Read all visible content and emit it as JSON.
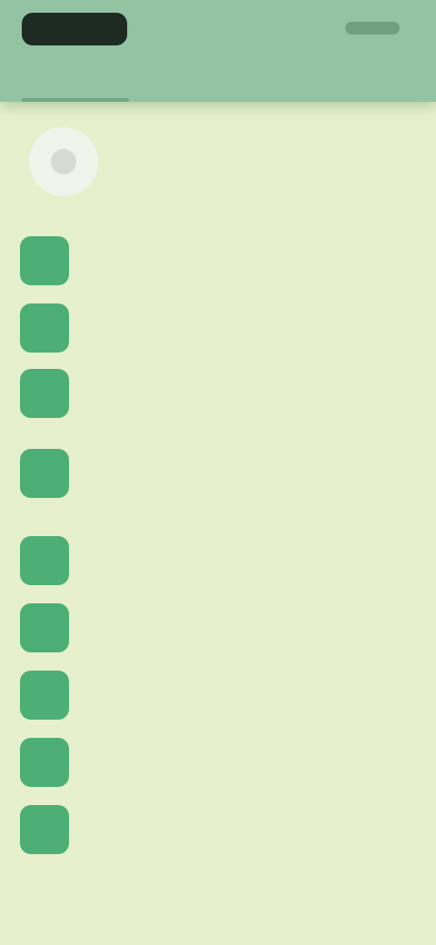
{
  "status_bar": {
    "time": "",
    "indicators": ""
  },
  "tabs": [
    {
      "label": ""
    },
    {
      "label": ""
    }
  ],
  "profile": {
    "name": "",
    "avatar_icon": "user-avatar-icon"
  },
  "menu": {
    "items": [
      {
        "label": "",
        "icon": "menu-item-icon"
      },
      {
        "label": "",
        "icon": "menu-item-icon"
      },
      {
        "label": "",
        "icon": "menu-item-icon"
      },
      {
        "label": "",
        "icon": "menu-item-icon"
      },
      {
        "label": "",
        "icon": "menu-item-icon"
      },
      {
        "label": "",
        "icon": "menu-item-icon"
      },
      {
        "label": "",
        "icon": "menu-item-icon"
      },
      {
        "label": "",
        "icon": "menu-item-icon"
      },
      {
        "label": "",
        "icon": "menu-item-icon"
      }
    ]
  },
  "colors": {
    "header_bg": "#93c3a3",
    "page_bg": "#e6f0cd",
    "icon_accent": "#4daf75"
  }
}
